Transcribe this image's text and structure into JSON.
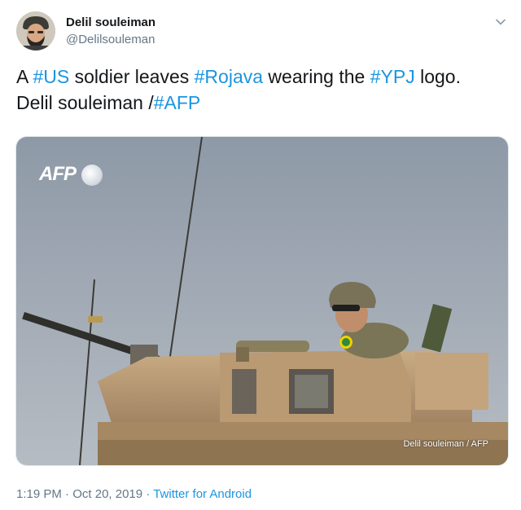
{
  "user": {
    "name": "Delil souleiman",
    "handle": "@Delilsouleman"
  },
  "tweet": {
    "parts": [
      "A ",
      "#US",
      " soldier leaves ",
      "#Rojava",
      " wearing the ",
      "#YPJ",
      " logo.",
      "Delil souleiman /",
      "#AFP"
    ]
  },
  "media": {
    "logo_text": "AFP",
    "credit": "Delil souleiman / AFP"
  },
  "meta": {
    "time": "1:19 PM",
    "sep1": " · ",
    "date": "Oct 20, 2019",
    "sep2": " · ",
    "source": "Twitter for Android"
  },
  "colors": {
    "link": "#1b95e0",
    "secondary_text": "#657786"
  },
  "icons": [
    "chevron-down-icon"
  ]
}
